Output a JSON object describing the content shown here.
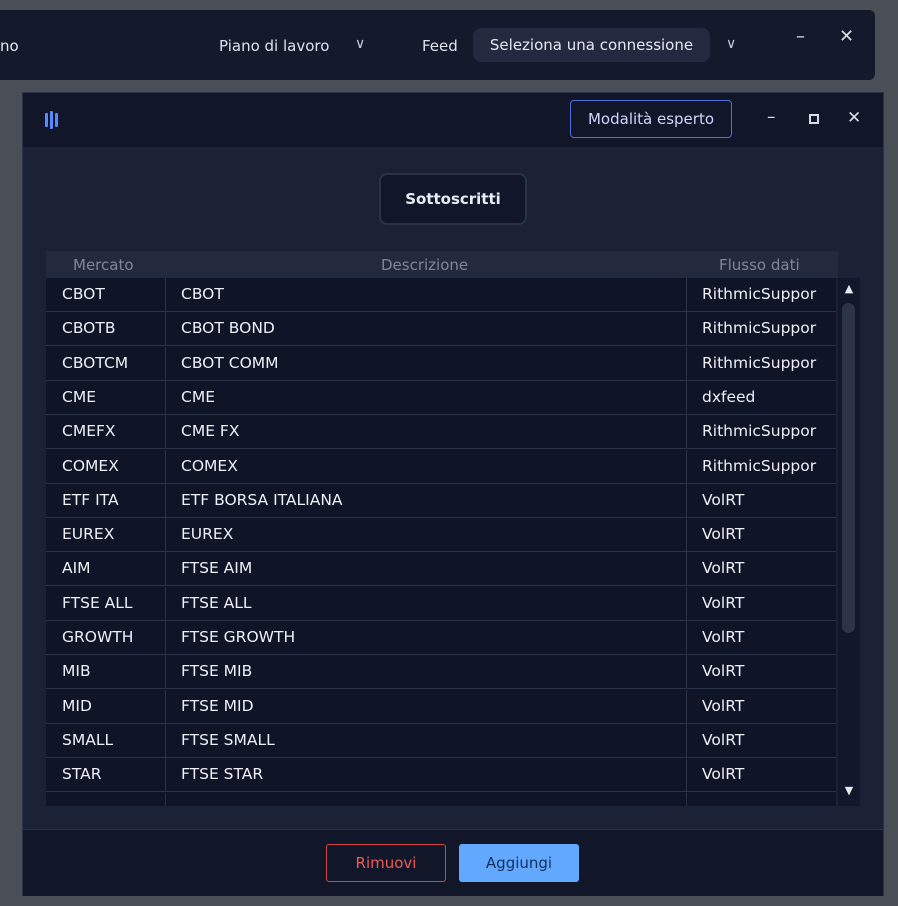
{
  "back_window": {
    "left_fragment": "no",
    "workspace_label": "Piano di lavoro",
    "feed_label": "Feed",
    "connection_placeholder": "Seleziona una connessione"
  },
  "dialog": {
    "expert_mode_label": "Modalità esperto",
    "tab_subscribed": "Sottoscritti",
    "columns": {
      "market": "Mercato",
      "description": "Descrizione",
      "data_feed": "Flusso dati"
    },
    "rows": [
      {
        "market": "CBOT",
        "description": "CBOT",
        "feed": "RithmicSuppor"
      },
      {
        "market": "CBOTB",
        "description": "CBOT BOND",
        "feed": "RithmicSuppor"
      },
      {
        "market": "CBOTCM",
        "description": "CBOT COMM",
        "feed": "RithmicSuppor"
      },
      {
        "market": "CME",
        "description": "CME",
        "feed": "dxfeed"
      },
      {
        "market": "CMEFX",
        "description": "CME FX",
        "feed": "RithmicSuppor"
      },
      {
        "market": "COMEX",
        "description": "COMEX",
        "feed": "RithmicSuppor"
      },
      {
        "market": "ETF ITA",
        "description": "ETF BORSA ITALIANA",
        "feed": "VolRT"
      },
      {
        "market": "EUREX",
        "description": "EUREX",
        "feed": "VolRT"
      },
      {
        "market": "AIM",
        "description": "FTSE AIM",
        "feed": "VolRT"
      },
      {
        "market": "FTSE ALL",
        "description": "FTSE ALL",
        "feed": "VolRT"
      },
      {
        "market": "GROWTH",
        "description": "FTSE GROWTH",
        "feed": "VolRT"
      },
      {
        "market": "MIB",
        "description": "FTSE MIB",
        "feed": "VolRT"
      },
      {
        "market": "MID",
        "description": "FTSE MID",
        "feed": "VolRT"
      },
      {
        "market": "SMALL",
        "description": "FTSE SMALL",
        "feed": "VolRT"
      },
      {
        "market": "STAR",
        "description": "FTSE STAR",
        "feed": "VolRT"
      }
    ],
    "remove_label": "Rimuovi",
    "add_label": "Aggiungi"
  },
  "colors": {
    "accent": "#63a8ff",
    "danger": "#d64545",
    "dialog_bg": "#1b2236",
    "table_bg": "#0f1426"
  }
}
